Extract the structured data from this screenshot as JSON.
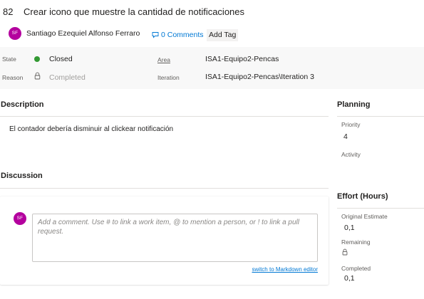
{
  "work_item": {
    "id": "82",
    "title": "Crear icono que muestre la cantidad de notificaciones",
    "owner": {
      "initials": "SF",
      "name": "Santiago Ezequiel Alfonso Ferraro",
      "avatar_color": "#b4009e"
    },
    "comments_label": "0 Comments",
    "add_tag_label": "Add Tag"
  },
  "fields": {
    "state": {
      "label": "State",
      "value": "Closed",
      "color": "#339933"
    },
    "reason": {
      "label": "Reason",
      "value": "Completed",
      "icon": "lock-icon"
    },
    "area": {
      "label": "Area",
      "value": "ISA1-Equipo2-Pencas"
    },
    "iteration": {
      "label": "Iteration",
      "value": "ISA1-Equipo2-Pencas\\Iteration 3"
    }
  },
  "description": {
    "heading": "Description",
    "text": "El contador debería disminuir al clickear notificación"
  },
  "discussion": {
    "heading": "Discussion",
    "commenter_initials": "SF",
    "comment_placeholder": "Add a comment. Use # to link a work item, @ to mention a person, or ! to link a pull request.",
    "markdown_link": "switch to Markdown editor"
  },
  "planning": {
    "heading": "Planning",
    "priority_label": "Priority",
    "priority_value": "4",
    "activity_label": "Activity"
  },
  "effort": {
    "heading": "Effort (Hours)",
    "original_estimate_label": "Original Estimate",
    "original_estimate_value": "0,1",
    "remaining_label": "Remaining",
    "remaining_icon": "lock-icon",
    "completed_label": "Completed",
    "completed_value": "0,1"
  },
  "colors": {
    "accent": "#0078d4",
    "avatar": "#b4009e",
    "closed_state": "#339933"
  }
}
